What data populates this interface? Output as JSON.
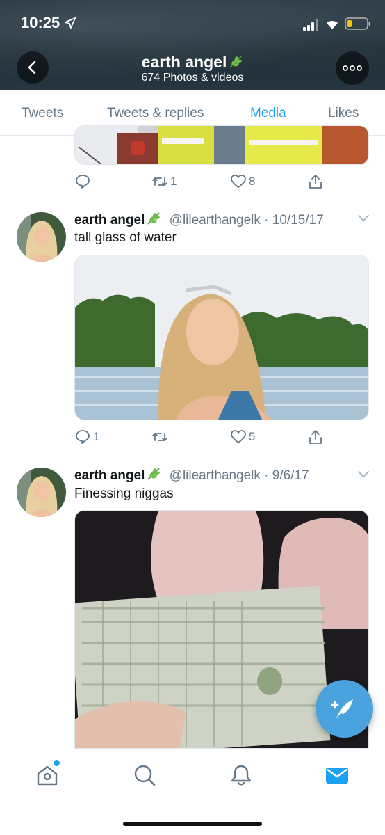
{
  "status_bar": {
    "time": "10:25"
  },
  "header": {
    "title": "earth angel",
    "subtitle": "674 Photos & videos"
  },
  "tabs": [
    {
      "label": "Tweets",
      "active": false
    },
    {
      "label": "Tweets & replies",
      "active": false
    },
    {
      "label": "Media",
      "active": true
    },
    {
      "label": "Likes",
      "active": false
    }
  ],
  "tweets": [
    {
      "media": "partial photo of people in high-visibility vests",
      "replies": "",
      "retweets": "1",
      "likes": "8"
    },
    {
      "name": "earth angel",
      "handle": "@lilearthangelk",
      "date": "10/15/17",
      "text": "tall glass of water",
      "media": "photo of smiling woman by a lake",
      "replies": "1",
      "retweets": "",
      "likes": "5"
    },
    {
      "name": "earth angel",
      "handle": "@lilearthangelk",
      "date": "9/6/17",
      "text": "Finessing niggas",
      "media": "photo of a fan of dollar bills"
    }
  ],
  "colors": {
    "accent": "#1da1f2",
    "secondary_text": "#657786",
    "fab": "#4aa3df"
  },
  "icons": {
    "header": [
      "back-icon",
      "more-icon"
    ],
    "bottom_nav": [
      "home-icon",
      "search-icon",
      "notifications-icon",
      "messages-icon"
    ],
    "fab": "compose-icon"
  }
}
